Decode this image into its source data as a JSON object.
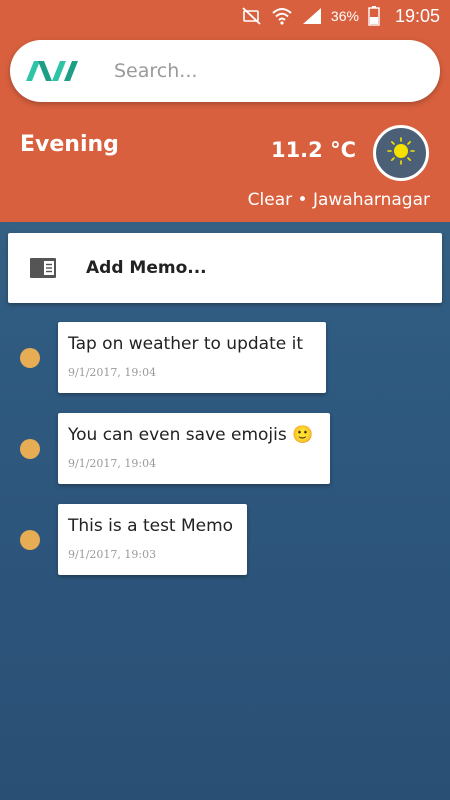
{
  "status_bar": {
    "icons": [
      "mute-icon",
      "wifi-icon",
      "signal-icon"
    ],
    "battery": "36%",
    "time": "19:05"
  },
  "colors": {
    "header": "#d8603e",
    "accent_dot": "#e6ad55",
    "logo_green": "#2ec4a5",
    "background": "#2f5a80"
  },
  "search": {
    "placeholder": "Search..."
  },
  "weather": {
    "greeting": "Evening",
    "temperature": "11.2 °C",
    "condition": "Clear • Jawaharnagar",
    "icon": "sun-icon"
  },
  "add_memo": {
    "label": "Add Memo...",
    "icon": "memo-icon"
  },
  "memos": [
    {
      "text": "Tap on weather to update it",
      "timestamp": "9/1/2017, 19:04"
    },
    {
      "text": "You can even save emojis 🙂",
      "timestamp": "9/1/2017, 19:04"
    },
    {
      "text": "This is a test Memo",
      "timestamp": "9/1/2017, 19:03"
    }
  ]
}
